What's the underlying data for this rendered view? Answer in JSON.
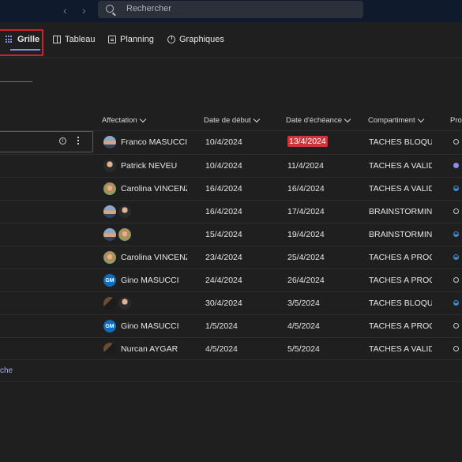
{
  "search": {
    "placeholder": "Rechercher"
  },
  "tabs": [
    {
      "label": "Grille",
      "active": true
    },
    {
      "label": "Tableau",
      "active": false
    },
    {
      "label": "Planning",
      "active": false
    },
    {
      "label": "Graphiques",
      "active": false
    }
  ],
  "columns": {
    "assign": "Affectation",
    "start": "Date de début",
    "due": "Date d'échéance",
    "bucket": "Compartiment",
    "progress": "Prog"
  },
  "rows": [
    {
      "assign": "Franco MASUCCI",
      "start": "10/4/2024",
      "due": "13/4/2024",
      "bucket": "TACHES BLOQUEE",
      "overdue": true,
      "progress": "not-started"
    },
    {
      "assign": "Patrick NEVEU",
      "start": "10/4/2024",
      "due": "11/4/2024",
      "bucket": "TACHES A VALIDEI",
      "progress": "completed"
    },
    {
      "assign": "Carolina VINCENZO",
      "start": "16/4/2024",
      "due": "16/4/2024",
      "bucket": "TACHES A VALIDEI",
      "progress": "in-progress"
    },
    {
      "assign": "",
      "start": "16/4/2024",
      "due": "17/4/2024",
      "bucket": "BRAINSTORMING",
      "progress": "not-started"
    },
    {
      "assign": "",
      "start": "15/4/2024",
      "due": "19/4/2024",
      "bucket": "BRAINSTORMING",
      "progress": "in-progress"
    },
    {
      "assign": "Carolina VINCENZO",
      "start": "23/4/2024",
      "due": "25/4/2024",
      "bucket": "TACHES A PROGR.",
      "progress": "in-progress"
    },
    {
      "assign": "Gino MASUCCI",
      "start": "24/4/2024",
      "due": "26/4/2024",
      "bucket": "TACHES A PROGR.",
      "progress": "not-started"
    },
    {
      "assign": "",
      "start": "30/4/2024",
      "due": "3/5/2024",
      "bucket": "TACHES BLOQUEE",
      "progress": "in-progress"
    },
    {
      "assign": "Gino MASUCCI",
      "start": "1/5/2024",
      "due": "4/5/2024",
      "bucket": "TACHES A PROGR.",
      "progress": "not-started"
    },
    {
      "assign": "Nurcan AYGAR",
      "start": "4/5/2024",
      "due": "5/5/2024",
      "bucket": "TACHES A VALIDEI",
      "progress": "not-started"
    }
  ],
  "avatar_initials": "GM",
  "footer": {
    "text": "che"
  }
}
